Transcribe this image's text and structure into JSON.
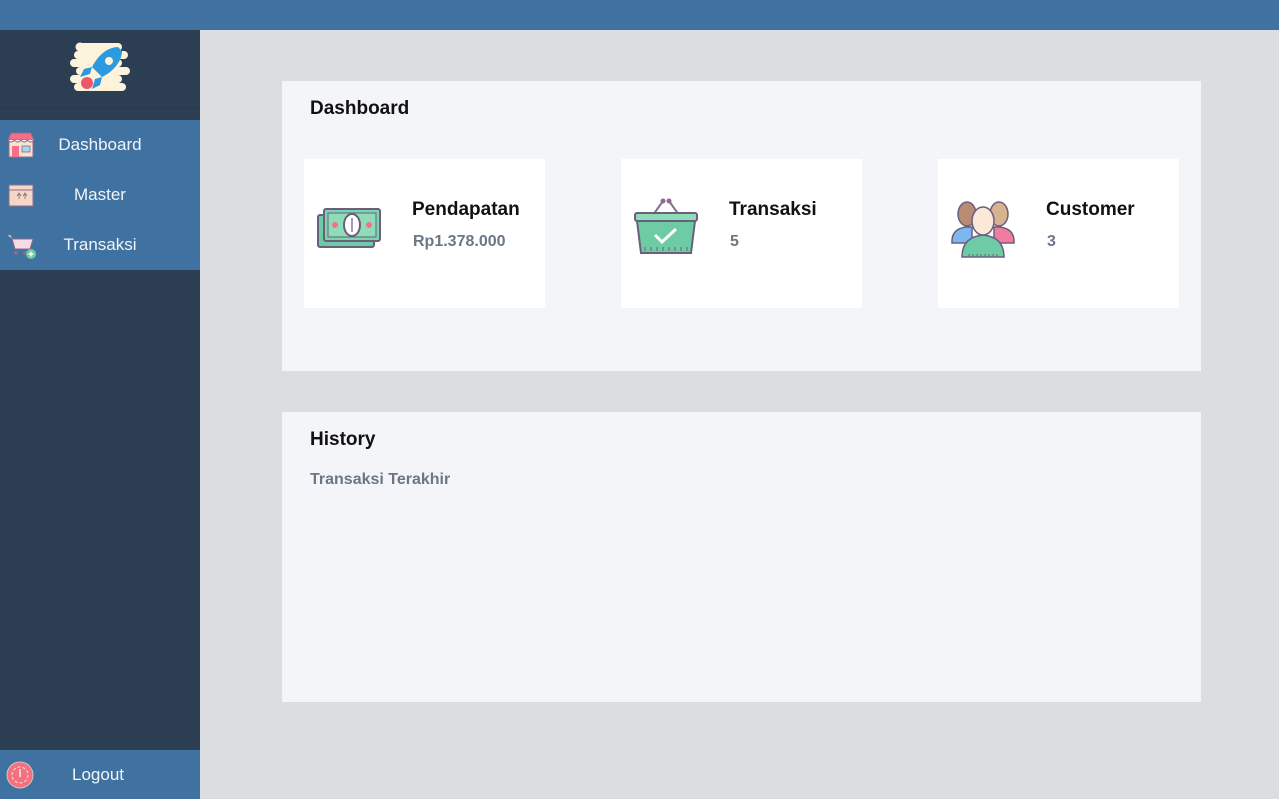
{
  "sidebar": {
    "logo_icon": "rocket-logo-icon",
    "items": [
      {
        "label": "Dashboard",
        "icon": "store-icon"
      },
      {
        "label": "Master",
        "icon": "box-icon"
      },
      {
        "label": "Transaksi",
        "icon": "cart-add-icon"
      }
    ],
    "logout": {
      "label": "Logout",
      "icon": "power-icon"
    }
  },
  "dashboard": {
    "title": "Dashboard",
    "cards": [
      {
        "label": "Pendapatan",
        "value": "Rp1.378.000",
        "icon": "money-icon"
      },
      {
        "label": "Transaksi",
        "value": "5",
        "icon": "basket-icon"
      },
      {
        "label": "Customer",
        "value": "3",
        "icon": "users-icon"
      }
    ]
  },
  "history": {
    "title": "History",
    "subtitle": "Transaksi Terakhir"
  },
  "colors": {
    "topbar": "#3f72a0",
    "sidebar": "#2c3e51",
    "nav_active": "#3f72a0",
    "background": "#dcdde0",
    "panel": "#f4f5f9",
    "muted_text": "#6b7787"
  }
}
